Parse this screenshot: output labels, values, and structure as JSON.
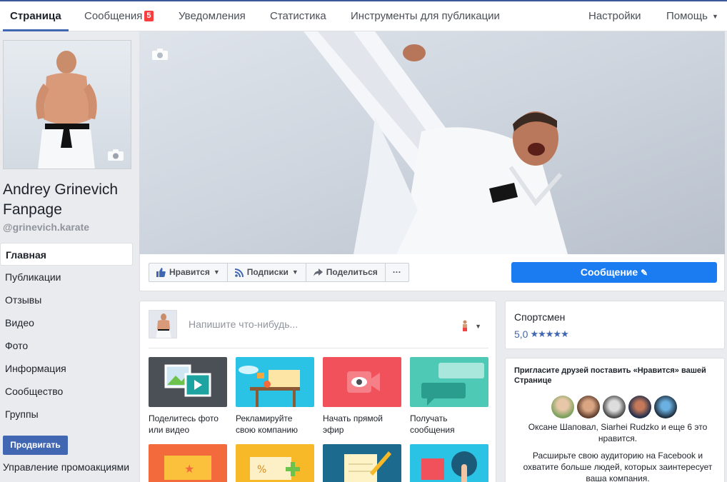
{
  "topnav": {
    "tabs": [
      {
        "label": "Страница",
        "active": true
      },
      {
        "label": "Сообщения",
        "badge": "5"
      },
      {
        "label": "Уведомления"
      },
      {
        "label": "Статистика"
      },
      {
        "label": "Инструменты для публикации"
      }
    ],
    "settings": "Настройки",
    "help": "Помощь"
  },
  "profile": {
    "name": "Andrey Grinevich Fanpage",
    "handle": "@grinevich.karate"
  },
  "leftnav": {
    "items": [
      "Главная",
      "Публикации",
      "Отзывы",
      "Видео",
      "Фото",
      "Информация",
      "Сообщество",
      "Группы"
    ],
    "promote": "Продвигать",
    "promotions": "Управление промоакциями"
  },
  "actions": {
    "like": "Нравится",
    "subscriptions": "Подписки",
    "share": "Поделиться",
    "more": "···",
    "message": "Сообщение"
  },
  "composer": {
    "placeholder": "Напишите что-нибудь...",
    "tiles": [
      {
        "caption": "Поделитесь фото или видео",
        "color": "#4b4f56"
      },
      {
        "caption": "Рекламируйте свою компанию",
        "color": "#2ac3e6"
      },
      {
        "caption": "Начать прямой эфир",
        "color": "#f0515b"
      },
      {
        "caption": "Получать сообщения",
        "color": "#4dc9b5"
      }
    ],
    "row2_colors": [
      "#f36a3c",
      "#f7b928",
      "#1c6b8f",
      "#2ac3e6"
    ]
  },
  "about": {
    "category": "Спортсмен",
    "rating": "5,0"
  },
  "invite": {
    "title": "Пригласите друзей поставить «Нравится» вашей Странице",
    "liked_text": "Оксане Шаповал, Siarhei Rudzko и еще 6 это нравится.",
    "expand_text": "Расширьте свою аудиторию на Facebook и охватите больше людей, которых заинтересует ваша компания."
  },
  "colors": {
    "brand": "#4267b2",
    "message_button": "#1a7cf0",
    "badge": "#fa3e3e"
  }
}
